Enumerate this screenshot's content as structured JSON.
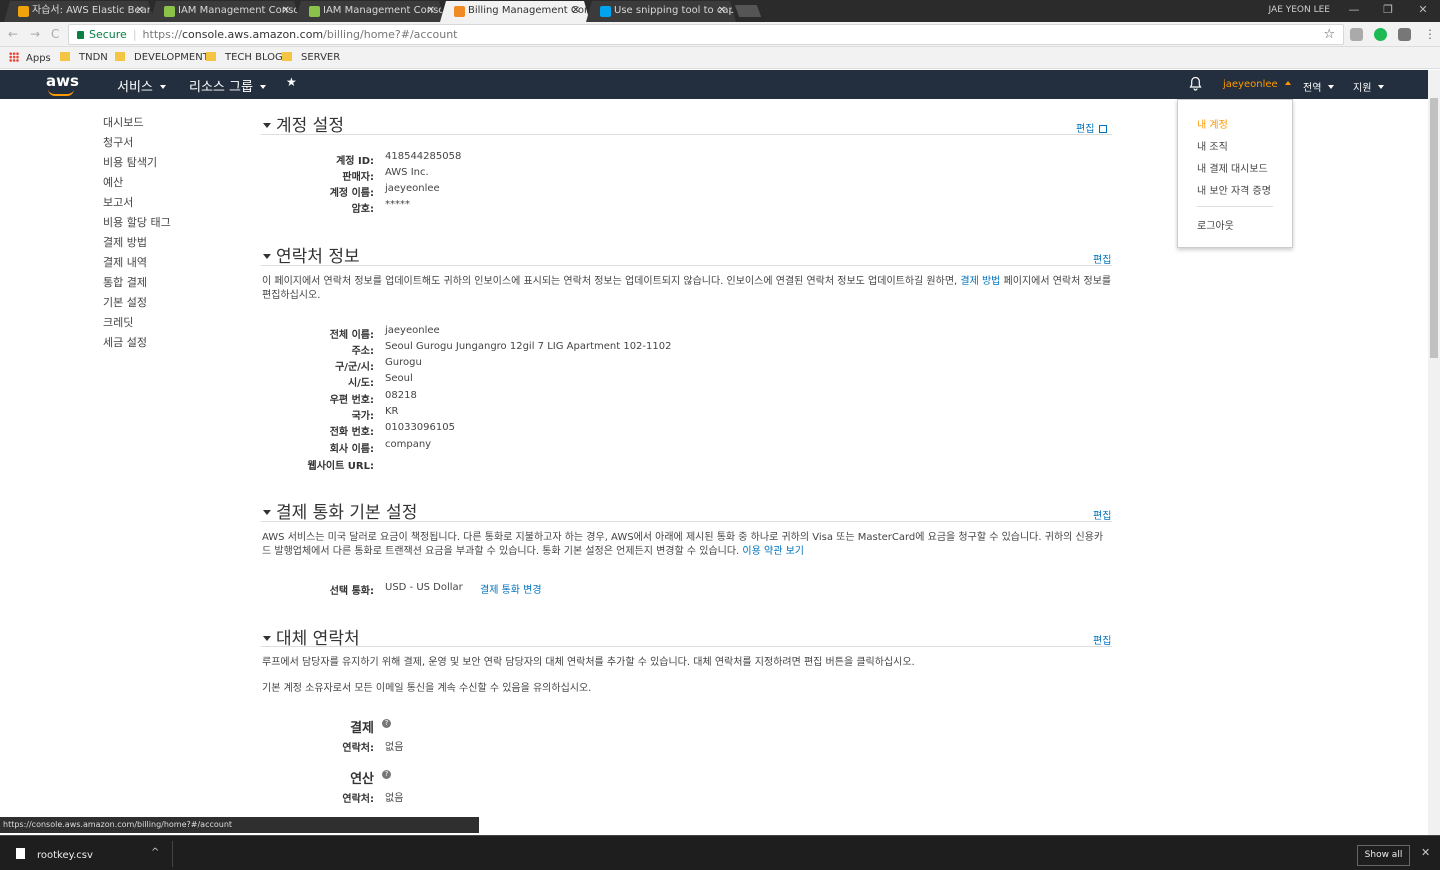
{
  "browser": {
    "tabs": [
      {
        "title": "자습서: AWS Elastic Bean",
        "favicon_color": "#f0a30a"
      },
      {
        "title": "IAM Management Conso",
        "favicon_color": "#8bc34a"
      },
      {
        "title": "IAM Management Conso",
        "favicon_color": "#8bc34a"
      },
      {
        "title": "Billing Management Con",
        "favicon_color": "#f08a24",
        "active": true
      },
      {
        "title": "Use snipping tool to capt",
        "favicon_color": "#00a4ef"
      }
    ],
    "tab_close": "✕",
    "window_user": "JAE YEON LEE",
    "window_buttons": {
      "minimize": "—",
      "restore": "❐",
      "close": "✕"
    },
    "nav_icons": {
      "back": "←",
      "forward": "→",
      "reload": "C"
    },
    "secure_label": "Secure",
    "url_scheme": "https://",
    "url_host": "console.aws.amazon.com",
    "url_path": "/billing/home?#/account",
    "bookmark_star": "☆",
    "bookmarks": {
      "apps": "Apps",
      "items": [
        "TNDN",
        "DEVELOPMENT",
        "TECH BLOG",
        "SERVER"
      ]
    }
  },
  "aws_header": {
    "logo": "aws",
    "services": "서비스",
    "resource_groups": "리소스 그룹",
    "pin": "★",
    "user": "jaeyeonlee",
    "region": "전역",
    "support": "지원"
  },
  "account_menu": {
    "items": [
      "내 계정",
      "내 조직",
      "내 결제 대시보드",
      "내 보안 자격 증명"
    ],
    "logout": "로그아웃"
  },
  "sidebar": {
    "items": [
      "대시보드",
      "청구서",
      "비용 탐색기",
      "예산",
      "보고서",
      "비용 할당 태그",
      "결제 방법",
      "결제 내역",
      "통합 결제",
      "기본 설정",
      "크레딧",
      "세금 설정"
    ]
  },
  "account_settings": {
    "title": "계정 설정",
    "edit": "편집",
    "fields": [
      {
        "label": "계정 ID:",
        "value": "418544285058"
      },
      {
        "label": "판매자:",
        "value": "AWS Inc."
      },
      {
        "label": "계정 이름:",
        "value": "jaeyeonlee"
      },
      {
        "label": "암호:",
        "value": "*****"
      }
    ]
  },
  "contact_info": {
    "title": "연락처 정보",
    "edit": "편집",
    "desc_1": "이 페이지에서 연락처 정보를 업데이트해도 귀하의 인보이스에 표시되는 연락처 정보는 업데이트되지 않습니다. 인보이스에 연결된 연락처 정보도 업데이트하길 원하면, ",
    "desc_link": "결제 방법",
    "desc_2": " 페이지에서 연락처 정보를 편집하십시오.",
    "fields": [
      {
        "label": "전체 이름:",
        "value": "jaeyeonlee"
      },
      {
        "label": "주소:",
        "value": "Seoul Gurogu Jungangro 12gil 7 LIG Apartment 102-1102"
      },
      {
        "label": "구/군/시:",
        "value": "Gurogu"
      },
      {
        "label": "시/도:",
        "value": "Seoul"
      },
      {
        "label": "우편 번호:",
        "value": "08218"
      },
      {
        "label": "국가:",
        "value": "KR"
      },
      {
        "label": "전화 번호:",
        "value": "01033096105"
      },
      {
        "label": "회사 이름:",
        "value": "company"
      },
      {
        "label": "웹사이트 URL:",
        "value": ""
      }
    ]
  },
  "currency": {
    "title": "결제 통화 기본 설정",
    "edit": "편집",
    "desc": "AWS 서비스는 미국 달러로 요금이 책정됩니다. 다른 통화로 지불하고자 하는 경우, AWS에서 아래에 제시된 통화 중 하나로 귀하의 Visa 또는 MasterCard에 요금을 청구할 수 있습니다. 귀하의 신용카드 발행업체에서 다른 통화로 트랜잭션 요금을 부과할 수 있습니다. 통화 기본 설정은 언제든지 변경할 수 있습니다. ",
    "terms_link": "이용 약관 보기",
    "selected_label": "선택 통화:",
    "selected_value": "USD - US Dollar",
    "change_link": "결제 통화 변경"
  },
  "alternate_contacts": {
    "title": "대체 연락처",
    "edit": "편집",
    "desc_1": "루프에서 담당자를 유지하기 위해 결제, 운영 및 보안 연락 담당자의 대체 연락처를 추가할 수 있습니다. 대체 연락처를 지정하려면 편집 버튼을 클릭하십시오.",
    "desc_2": "기본 계정 소유자로서 모든 이메일 통신을 계속 수신할 수 있음을 유의하십시오.",
    "groups": [
      {
        "name": "결제",
        "help": "?",
        "label": "연락처:",
        "value": "없음"
      },
      {
        "name": "연산",
        "help": "?",
        "label": "연락처:",
        "value": "없음"
      }
    ]
  },
  "status_bar": {
    "url": "https://console.aws.amazon.com/billing/home?#/account"
  },
  "downloads": {
    "file": "rootkey.csv",
    "caret": "^",
    "show_all": "Show all",
    "close": "✕"
  }
}
